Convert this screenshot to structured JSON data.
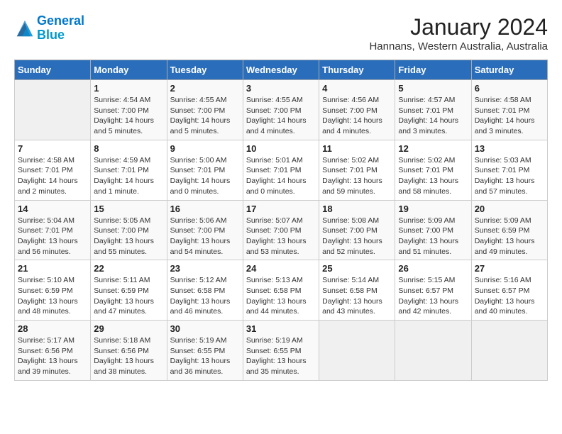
{
  "header": {
    "logo_line1": "General",
    "logo_line2": "Blue",
    "month": "January 2024",
    "location": "Hannans, Western Australia, Australia"
  },
  "calendar": {
    "days_of_week": [
      "Sunday",
      "Monday",
      "Tuesday",
      "Wednesday",
      "Thursday",
      "Friday",
      "Saturday"
    ],
    "weeks": [
      [
        {
          "day": "",
          "info": ""
        },
        {
          "day": "1",
          "info": "Sunrise: 4:54 AM\nSunset: 7:00 PM\nDaylight: 14 hours\nand 5 minutes."
        },
        {
          "day": "2",
          "info": "Sunrise: 4:55 AM\nSunset: 7:00 PM\nDaylight: 14 hours\nand 5 minutes."
        },
        {
          "day": "3",
          "info": "Sunrise: 4:55 AM\nSunset: 7:00 PM\nDaylight: 14 hours\nand 4 minutes."
        },
        {
          "day": "4",
          "info": "Sunrise: 4:56 AM\nSunset: 7:00 PM\nDaylight: 14 hours\nand 4 minutes."
        },
        {
          "day": "5",
          "info": "Sunrise: 4:57 AM\nSunset: 7:01 PM\nDaylight: 14 hours\nand 3 minutes."
        },
        {
          "day": "6",
          "info": "Sunrise: 4:58 AM\nSunset: 7:01 PM\nDaylight: 14 hours\nand 3 minutes."
        }
      ],
      [
        {
          "day": "7",
          "info": "Sunrise: 4:58 AM\nSunset: 7:01 PM\nDaylight: 14 hours\nand 2 minutes."
        },
        {
          "day": "8",
          "info": "Sunrise: 4:59 AM\nSunset: 7:01 PM\nDaylight: 14 hours\nand 1 minute."
        },
        {
          "day": "9",
          "info": "Sunrise: 5:00 AM\nSunset: 7:01 PM\nDaylight: 14 hours\nand 0 minutes."
        },
        {
          "day": "10",
          "info": "Sunrise: 5:01 AM\nSunset: 7:01 PM\nDaylight: 14 hours\nand 0 minutes."
        },
        {
          "day": "11",
          "info": "Sunrise: 5:02 AM\nSunset: 7:01 PM\nDaylight: 13 hours\nand 59 minutes."
        },
        {
          "day": "12",
          "info": "Sunrise: 5:02 AM\nSunset: 7:01 PM\nDaylight: 13 hours\nand 58 minutes."
        },
        {
          "day": "13",
          "info": "Sunrise: 5:03 AM\nSunset: 7:01 PM\nDaylight: 13 hours\nand 57 minutes."
        }
      ],
      [
        {
          "day": "14",
          "info": "Sunrise: 5:04 AM\nSunset: 7:01 PM\nDaylight: 13 hours\nand 56 minutes."
        },
        {
          "day": "15",
          "info": "Sunrise: 5:05 AM\nSunset: 7:00 PM\nDaylight: 13 hours\nand 55 minutes."
        },
        {
          "day": "16",
          "info": "Sunrise: 5:06 AM\nSunset: 7:00 PM\nDaylight: 13 hours\nand 54 minutes."
        },
        {
          "day": "17",
          "info": "Sunrise: 5:07 AM\nSunset: 7:00 PM\nDaylight: 13 hours\nand 53 minutes."
        },
        {
          "day": "18",
          "info": "Sunrise: 5:08 AM\nSunset: 7:00 PM\nDaylight: 13 hours\nand 52 minutes."
        },
        {
          "day": "19",
          "info": "Sunrise: 5:09 AM\nSunset: 7:00 PM\nDaylight: 13 hours\nand 51 minutes."
        },
        {
          "day": "20",
          "info": "Sunrise: 5:09 AM\nSunset: 6:59 PM\nDaylight: 13 hours\nand 49 minutes."
        }
      ],
      [
        {
          "day": "21",
          "info": "Sunrise: 5:10 AM\nSunset: 6:59 PM\nDaylight: 13 hours\nand 48 minutes."
        },
        {
          "day": "22",
          "info": "Sunrise: 5:11 AM\nSunset: 6:59 PM\nDaylight: 13 hours\nand 47 minutes."
        },
        {
          "day": "23",
          "info": "Sunrise: 5:12 AM\nSunset: 6:58 PM\nDaylight: 13 hours\nand 46 minutes."
        },
        {
          "day": "24",
          "info": "Sunrise: 5:13 AM\nSunset: 6:58 PM\nDaylight: 13 hours\nand 44 minutes."
        },
        {
          "day": "25",
          "info": "Sunrise: 5:14 AM\nSunset: 6:58 PM\nDaylight: 13 hours\nand 43 minutes."
        },
        {
          "day": "26",
          "info": "Sunrise: 5:15 AM\nSunset: 6:57 PM\nDaylight: 13 hours\nand 42 minutes."
        },
        {
          "day": "27",
          "info": "Sunrise: 5:16 AM\nSunset: 6:57 PM\nDaylight: 13 hours\nand 40 minutes."
        }
      ],
      [
        {
          "day": "28",
          "info": "Sunrise: 5:17 AM\nSunset: 6:56 PM\nDaylight: 13 hours\nand 39 minutes."
        },
        {
          "day": "29",
          "info": "Sunrise: 5:18 AM\nSunset: 6:56 PM\nDaylight: 13 hours\nand 38 minutes."
        },
        {
          "day": "30",
          "info": "Sunrise: 5:19 AM\nSunset: 6:55 PM\nDaylight: 13 hours\nand 36 minutes."
        },
        {
          "day": "31",
          "info": "Sunrise: 5:19 AM\nSunset: 6:55 PM\nDaylight: 13 hours\nand 35 minutes."
        },
        {
          "day": "",
          "info": ""
        },
        {
          "day": "",
          "info": ""
        },
        {
          "day": "",
          "info": ""
        }
      ]
    ]
  }
}
